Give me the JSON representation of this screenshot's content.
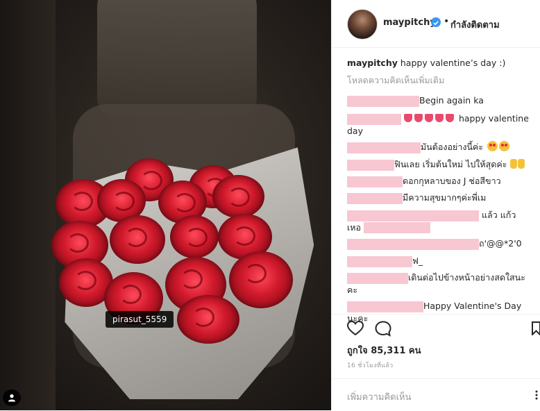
{
  "photo": {
    "tag_label": "pirasut_5559",
    "user_tag_icon": "user-icon"
  },
  "header": {
    "username": "maypitchy",
    "separator": "•",
    "follow_status": "กำลังติดตาม",
    "verified_icon": "verified-badge-icon"
  },
  "caption": {
    "username": "maypitchy",
    "text": "happy valentine’s day :)"
  },
  "load_more": "โหลดความคิดเห็นเพิ่มเติม",
  "comments": [
    {
      "text": "Begin again ka"
    },
    {
      "text": "happy valentine day"
    },
    {
      "text": "มันต้องอย่างนี้ค่ะ"
    },
    {
      "text": "ฟินเลย เริ่มต้นใหม่ ไปให้สุดค่ะ"
    },
    {
      "text": "ดอกกุหลาบของ J ช่อสีขาว"
    },
    {
      "text": "มีความสุขมากๆค่ะพี่เม"
    },
    {
      "text": "แล้ว แก้ว"
    },
    {
      "text": "เหอ"
    },
    {
      "text": "ถ'@@*2'0"
    },
    {
      "text": "ฟ_"
    },
    {
      "text": "เดินต่อไปข้างหน้าอย่างสดใสนะ"
    },
    {
      "text": "คะ"
    },
    {
      "text": "Happy Valentine's Day นะคะ"
    }
  ],
  "actions": {
    "like_icon": "heart-icon",
    "comment_icon": "comment-icon",
    "save_icon": "bookmark-icon"
  },
  "likes_text": "ถูกใจ 85,311 คน",
  "time_text": "16 ชั่วโมงที่แล้ว",
  "add_comment_placeholder": "เพิ่มความคิดเห็น",
  "more_icon": "ellipsis-icon",
  "colors": {
    "verified": "#3897f0",
    "muted": "#999999",
    "redacted": "#f7c7d2"
  }
}
